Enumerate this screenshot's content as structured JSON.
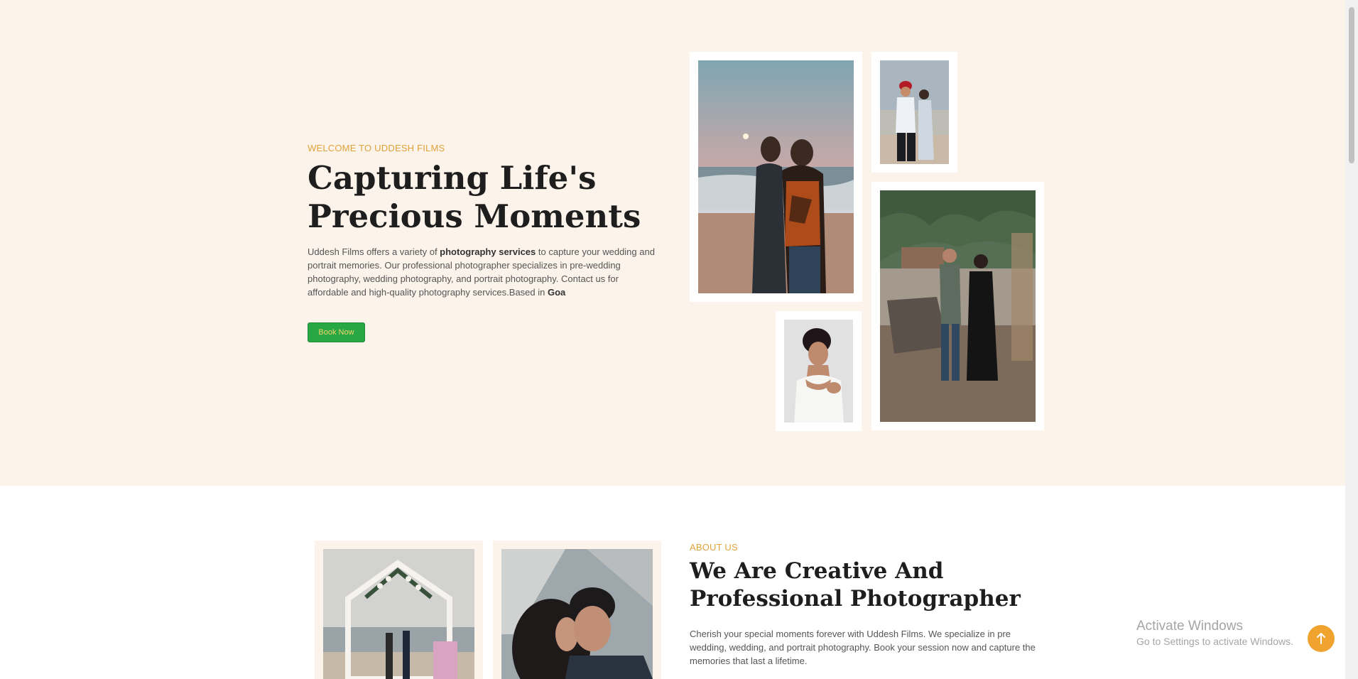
{
  "hero": {
    "eyebrow": "WELCOME TO UDDESH FILMS",
    "title_line1": "Capturing Life's",
    "title_line2": "Precious Moments",
    "desc_intro": "Uddesh Films offers a variety of ",
    "desc_bold": "photography services",
    "desc_rest": " to capture your wedding and portrait memories. Our professional photographer specializes in pre-wedding photography, wedding photography, and portrait photography. Contact us for affordable and high-quality photography services.Based in ",
    "desc_location": "Goa",
    "book_label": "Book Now"
  },
  "about": {
    "eyebrow": "ABOUT US",
    "title_line1": "We Are Creative And",
    "title_line2": "Professional Photographer",
    "desc": "Cherish your special moments forever with Uddesh Films. We specialize in pre wedding, wedding, and portrait photography. Book your session now and capture the memories that last a lifetime."
  },
  "overlay": {
    "activate_title": "Activate Windows",
    "activate_sub": "Go to Settings to activate Windows."
  },
  "colors": {
    "hero_bg": "#fcf3ea",
    "accent": "#e0a33a",
    "button_green": "#28a745",
    "back_to_top": "#f0a32e"
  },
  "icons": {
    "back_to_top": "arrow-up-icon"
  }
}
